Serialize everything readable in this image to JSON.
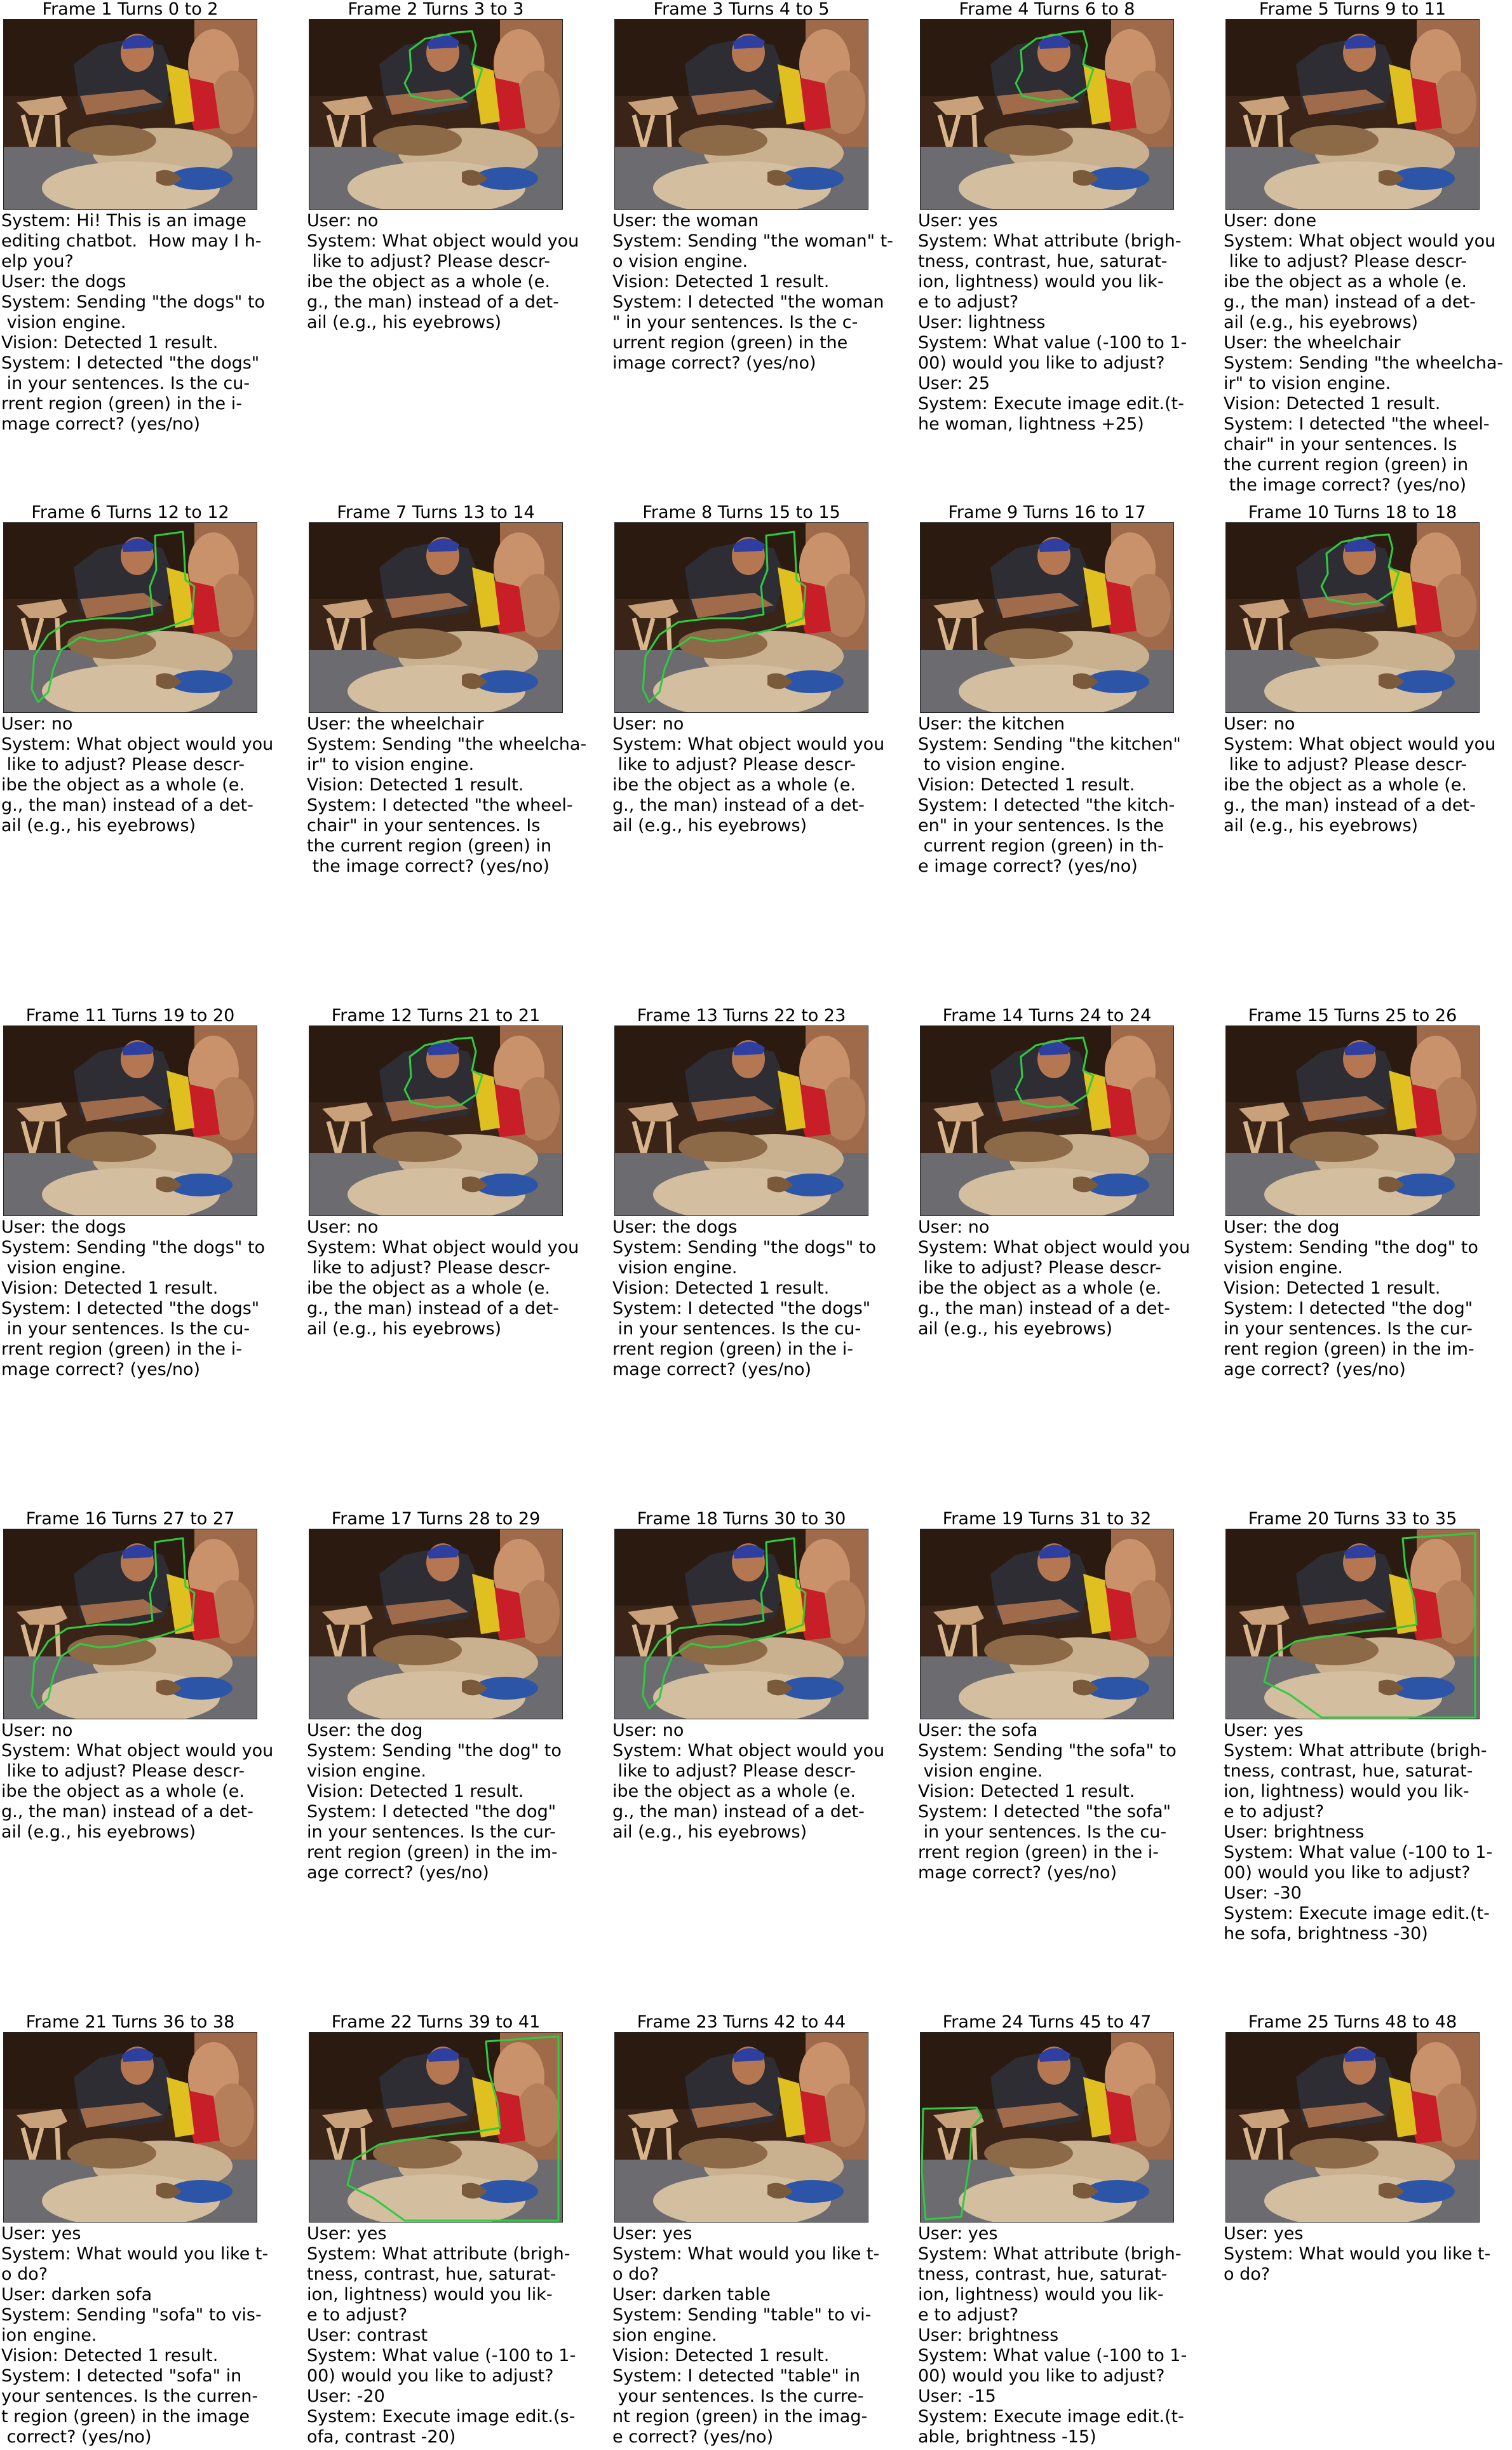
{
  "frames": [
    {
      "title": "Frame 1 Turns 0 to 2",
      "highlight": "none",
      "lines": [
        "System: Hi! This is an image",
        "editing chatbot.  How may I h-",
        "elp you?",
        "User: the dogs",
        "System: Sending \"the dogs\" to",
        " vision engine.",
        "Vision: Detected 1 result.",
        "System: I detected \"the dogs\"",
        " in your sentences. Is the cu-",
        "rrent region (green) in the i-",
        "mage correct? (yes/no)"
      ]
    },
    {
      "title": "Frame 2 Turns 3 to 3",
      "highlight": "woman",
      "lines": [
        "User: no",
        "System: What object would you",
        " like to adjust? Please descr-",
        "ibe the object as a whole (e.",
        "g., the man) instead of a det-",
        "ail (e.g., his eyebrows)"
      ]
    },
    {
      "title": "Frame 3 Turns 4 to 5",
      "highlight": "none",
      "lines": [
        "User: the woman",
        "System: Sending \"the woman\" t-",
        "o vision engine.",
        "Vision: Detected 1 result.",
        "System: I detected \"the woman",
        "\" in your sentences. Is the c-",
        "urrent region (green) in the",
        "image correct? (yes/no)"
      ]
    },
    {
      "title": "Frame 4 Turns 6 to 8",
      "highlight": "woman",
      "lines": [
        "User: yes",
        "System: What attribute (brigh-",
        "tness, contrast, hue, saturat-",
        "ion, lightness) would you lik-",
        "e to adjust?",
        "User: lightness",
        "System: What value (-100 to 1-",
        "00) would you like to adjust?",
        "User: 25",
        "System: Execute image edit.(t-",
        "he woman, lightness +25)"
      ]
    },
    {
      "title": "Frame 5 Turns 9 to 11",
      "highlight": "none",
      "lines": [
        "User: done",
        "System: What object would you",
        " like to adjust? Please descr-",
        "ibe the object as a whole (e.",
        "g., the man) instead of a det-",
        "ail (e.g., his eyebrows)",
        "User: the wheelchair",
        "System: Sending \"the wheelcha-",
        "ir\" to vision engine.",
        "Vision: Detected 1 result.",
        "System: I detected \"the wheel-",
        "chair\" in your sentences. Is",
        "the current region (green) in",
        " the image correct? (yes/no)"
      ]
    },
    {
      "title": "Frame 6 Turns 12 to 12",
      "highlight": "wheelchair",
      "lines": [
        "User: no",
        "System: What object would you",
        " like to adjust? Please descr-",
        "ibe the object as a whole (e.",
        "g., the man) instead of a det-",
        "ail (e.g., his eyebrows)"
      ]
    },
    {
      "title": "Frame 7 Turns 13 to 14",
      "highlight": "none",
      "lines": [
        "User: the wheelchair",
        "System: Sending \"the wheelcha-",
        "ir\" to vision engine.",
        "Vision: Detected 1 result.",
        "System: I detected \"the wheel-",
        "chair\" in your sentences. Is",
        "the current region (green) in",
        " the image correct? (yes/no)"
      ]
    },
    {
      "title": "Frame 8 Turns 15 to 15",
      "highlight": "wheelchair",
      "lines": [
        "User: no",
        "System: What object would you",
        " like to adjust? Please descr-",
        "ibe the object as a whole (e.",
        "g., the man) instead of a det-",
        "ail (e.g., his eyebrows)"
      ]
    },
    {
      "title": "Frame 9 Turns 16 to 17",
      "highlight": "none",
      "lines": [
        "User: the kitchen",
        "System: Sending \"the kitchen\"",
        " to vision engine.",
        "Vision: Detected 1 result.",
        "System: I detected \"the kitch-",
        "en\" in your sentences. Is the",
        " current region (green) in th-",
        "e image correct? (yes/no)"
      ]
    },
    {
      "title": "Frame 10 Turns 18 to 18",
      "highlight": "woman",
      "lines": [
        "User: no",
        "System: What object would you",
        " like to adjust? Please descr-",
        "ibe the object as a whole (e.",
        "g., the man) instead of a det-",
        "ail (e.g., his eyebrows)"
      ]
    },
    {
      "title": "Frame 11 Turns 19 to 20",
      "highlight": "none",
      "lines": [
        "User: the dogs",
        "System: Sending \"the dogs\" to",
        " vision engine.",
        "Vision: Detected 1 result.",
        "System: I detected \"the dogs\"",
        " in your sentences. Is the cu-",
        "rrent region (green) in the i-",
        "mage correct? (yes/no)"
      ]
    },
    {
      "title": "Frame 12 Turns 21 to 21",
      "highlight": "woman",
      "lines": [
        "User: no",
        "System: What object would you",
        " like to adjust? Please descr-",
        "ibe the object as a whole (e.",
        "g., the man) instead of a det-",
        "ail (e.g., his eyebrows)"
      ]
    },
    {
      "title": "Frame 13 Turns 22 to 23",
      "highlight": "none",
      "lines": [
        "User: the dogs",
        "System: Sending \"the dogs\" to",
        " vision engine.",
        "Vision: Detected 1 result.",
        "System: I detected \"the dogs\"",
        " in your sentences. Is the cu-",
        "rrent region (green) in the i-",
        "mage correct? (yes/no)"
      ]
    },
    {
      "title": "Frame 14 Turns 24 to 24",
      "highlight": "woman",
      "lines": [
        "User: no",
        "System: What object would you",
        " like to adjust? Please descr-",
        "ibe the object as a whole (e.",
        "g., the man) instead of a det-",
        "ail (e.g., his eyebrows)"
      ]
    },
    {
      "title": "Frame 15 Turns 25 to 26",
      "highlight": "none",
      "lines": [
        "User: the dog",
        "System: Sending \"the dog\" to",
        "vision engine.",
        "Vision: Detected 1 result.",
        "System: I detected \"the dog\"",
        "in your sentences. Is the cur-",
        "rent region (green) in the im-",
        "age correct? (yes/no)"
      ]
    },
    {
      "title": "Frame 16 Turns 27 to 27",
      "highlight": "wheelchair",
      "lines": [
        "User: no",
        "System: What object would you",
        " like to adjust? Please descr-",
        "ibe the object as a whole (e.",
        "g., the man) instead of a det-",
        "ail (e.g., his eyebrows)"
      ]
    },
    {
      "title": "Frame 17 Turns 28 to 29",
      "highlight": "none",
      "lines": [
        "User: the dog",
        "System: Sending \"the dog\" to",
        "vision engine.",
        "Vision: Detected 1 result.",
        "System: I detected \"the dog\"",
        "in your sentences. Is the cur-",
        "rent region (green) in the im-",
        "age correct? (yes/no)"
      ]
    },
    {
      "title": "Frame 18 Turns 30 to 30",
      "highlight": "wheelchair",
      "lines": [
        "User: no",
        "System: What object would you",
        " like to adjust? Please descr-",
        "ibe the object as a whole (e.",
        "g., the man) instead of a det-",
        "ail (e.g., his eyebrows)"
      ]
    },
    {
      "title": "Frame 19 Turns 31 to 32",
      "highlight": "none",
      "lines": [
        "User: the sofa",
        "System: Sending \"the sofa\" to",
        " vision engine.",
        "Vision: Detected 1 result.",
        "System: I detected \"the sofa\"",
        " in your sentences. Is the cu-",
        "rrent region (green) in the i-",
        "mage correct? (yes/no)"
      ]
    },
    {
      "title": "Frame 20 Turns 33 to 35",
      "highlight": "sofa",
      "lines": [
        "User: yes",
        "System: What attribute (brigh-",
        "tness, contrast, hue, saturat-",
        "ion, lightness) would you lik-",
        "e to adjust?",
        "User: brightness",
        "System: What value (-100 to 1-",
        "00) would you like to adjust?",
        "User: -30",
        "System: Execute image edit.(t-",
        "he sofa, brightness -30)"
      ]
    },
    {
      "title": "Frame 21 Turns 36 to 38",
      "highlight": "none",
      "lines": [
        "User: yes",
        "System: What would you like t-",
        "o do?",
        "User: darken sofa",
        "System: Sending \"sofa\" to vis-",
        "ion engine.",
        "Vision: Detected 1 result.",
        "System: I detected \"sofa\" in",
        "your sentences. Is the curren-",
        "t region (green) in the image",
        " correct? (yes/no)"
      ]
    },
    {
      "title": "Frame 22 Turns 39 to 41",
      "highlight": "sofa",
      "lines": [
        "User: yes",
        "System: What attribute (brigh-",
        "tness, contrast, hue, saturat-",
        "ion, lightness) would you lik-",
        "e to adjust?",
        "User: contrast",
        "System: What value (-100 to 1-",
        "00) would you like to adjust?",
        "User: -20",
        "System: Execute image edit.(s-",
        "ofa, contrast -20)"
      ]
    },
    {
      "title": "Frame 23 Turns 42 to 44",
      "highlight": "none",
      "lines": [
        "User: yes",
        "System: What would you like t-",
        "o do?",
        "User: darken table",
        "System: Sending \"table\" to vi-",
        "sion engine.",
        "Vision: Detected 1 result.",
        "System: I detected \"table\" in",
        " your sentences. Is the curre-",
        "nt region (green) in the imag-",
        "e correct? (yes/no)"
      ]
    },
    {
      "title": "Frame 24 Turns 45 to 47",
      "highlight": "table",
      "lines": [
        "User: yes",
        "System: What attribute (brigh-",
        "tness, contrast, hue, saturat-",
        "ion, lightness) would you lik-",
        "e to adjust?",
        "User: brightness",
        "System: What value (-100 to 1-",
        "00) would you like to adjust?",
        "User: -15",
        "System: Execute image edit.(t-",
        "able, brightness -15)"
      ]
    },
    {
      "title": "Frame 25 Turns 48 to 48",
      "highlight": "none",
      "lines": [
        "User: yes",
        "System: What would you like t-",
        "o do?"
      ]
    }
  ],
  "colors": {
    "highlight": "#2ecc40",
    "text": "#000000",
    "background": "#ffffff"
  }
}
